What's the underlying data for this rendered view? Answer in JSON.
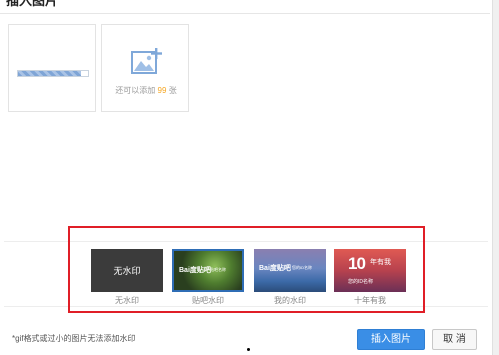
{
  "dialog": {
    "title": "插入图片",
    "close_icon": "close-icon"
  },
  "upload": {
    "uploading_progress": 0.9,
    "add_more_prefix": "还可以添加",
    "add_more_count": "99",
    "add_more_suffix": "张",
    "add_icon": "add-image-icon"
  },
  "watermark": {
    "options": [
      {
        "label": "无水印",
        "thumb_text": "无水印"
      },
      {
        "label": "贴吧水印",
        "thumb_brand": "Bai度贴吧",
        "thumb_sub": "贴吧名称"
      },
      {
        "label": "我的水印",
        "thumb_brand": "Bai度贴吧",
        "thumb_sub": "您的ID名称"
      },
      {
        "label": "十年有我",
        "thumb_big": "10",
        "thumb_small": "年有我",
        "thumb_sub": "您的ID名称"
      }
    ],
    "selected": "贴吧水印"
  },
  "footer": {
    "note": "*gif格式或过小的图片无法添加水印",
    "insert_label": "插入图片",
    "cancel_label": "取 消"
  },
  "colors": {
    "accent": "#3a8ee6",
    "highlight": "#e01e27",
    "count": "#f5a623"
  }
}
